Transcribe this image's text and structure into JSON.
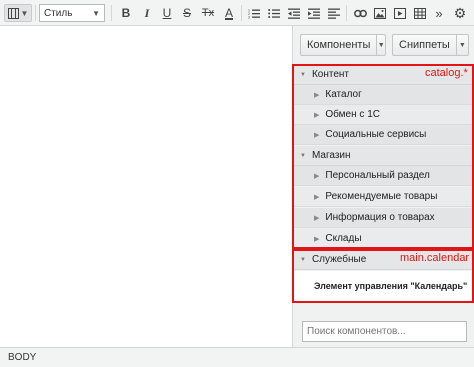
{
  "toolbar": {
    "mode_icon": "view-mode-icon",
    "style_select_value": "Стиль",
    "buttons": [
      {
        "name": "bold-button",
        "glyph": "B"
      },
      {
        "name": "italic-button",
        "glyph": "I"
      },
      {
        "name": "underline-button",
        "glyph": "U"
      },
      {
        "name": "strikethrough-button",
        "glyph": "S"
      },
      {
        "name": "remove-format-button",
        "glyph": "Tx"
      },
      {
        "name": "text-color-button",
        "glyph": "A"
      }
    ]
  },
  "panel": {
    "components_button": "Компоненты",
    "snippets_button": "Сниппеты",
    "groups": [
      {
        "label": "Контент"
      },
      {
        "label": "Магазин"
      },
      {
        "label": "Служебные"
      }
    ],
    "content_items": [
      "Каталог",
      "Обмен с 1С",
      "Социальные сервисы"
    ],
    "shop_items": [
      "Персональный раздел",
      "Рекомендуемые товары",
      "Информация о товарах",
      "Склады"
    ],
    "service_item": "Элемент управления \"Календарь\"",
    "search_placeholder": "Поиск компонентов..."
  },
  "annotations": {
    "catalog_label": "catalog.*",
    "calendar_label": "main.calendar",
    "color": "#e01515"
  },
  "status": {
    "path": "BODY"
  }
}
